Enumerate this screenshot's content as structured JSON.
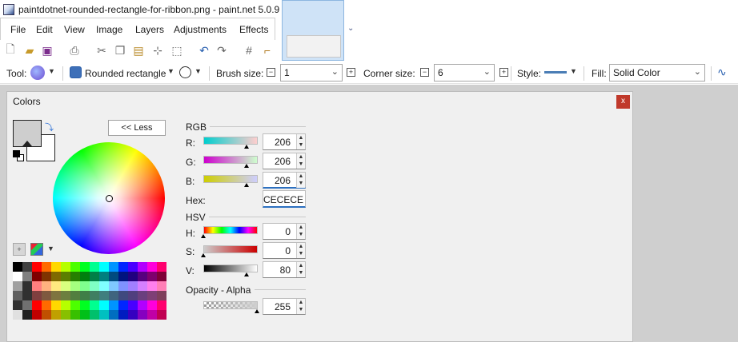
{
  "window": {
    "title": "paintdotnet-rounded-rectangle-for-ribbon.png - paint.net 5.0.9"
  },
  "menu": [
    "File",
    "Edit",
    "View",
    "Image",
    "Layers",
    "Adjustments",
    "Effects"
  ],
  "toolbar": {
    "icons": [
      "new-icon",
      "open-icon",
      "save-icon",
      "print-icon",
      "cut-icon",
      "copy-icon",
      "paste-icon",
      "crop-icon",
      "deselect-icon",
      "undo-icon",
      "redo-icon",
      "grid-icon",
      "ruler-icon"
    ]
  },
  "options": {
    "tool_label": "Tool:",
    "shape_label": "Rounded rectangle",
    "brush_size_label": "Brush size:",
    "brush_size_value": "1",
    "corner_size_label": "Corner size:",
    "corner_size_value": "6",
    "style_label": "Style:",
    "fill_label": "Fill:",
    "fill_value": "Solid Color",
    "style_color": "#4a7db5"
  },
  "colors_panel": {
    "title": "Colors",
    "close_label": "x",
    "less_label": "<< Less",
    "primary_color": "#cecece",
    "secondary_color": "#ffffff",
    "rgb_group": "RGB",
    "r_label": "R:",
    "r_value": "206",
    "g_label": "G:",
    "g_value": "206",
    "b_label": "B:",
    "b_value": "206",
    "hex_label": "Hex:",
    "hex_value": "CECECE",
    "hsv_group": "HSV",
    "h_label": "H:",
    "h_value": "0",
    "s_label": "S:",
    "s_value": "0",
    "v_label": "V:",
    "v_value": "80",
    "opacity_group": "Opacity - Alpha",
    "alpha_value": "255"
  },
  "palette": [
    [
      "#000000",
      "#404040",
      "#ff0000",
      "#ff6a00",
      "#ffd800",
      "#b6ff00",
      "#4cff00",
      "#00ff21",
      "#00ff90",
      "#00ffff",
      "#0094ff",
      "#0026ff",
      "#4800ff",
      "#b200ff",
      "#ff00dc",
      "#ff006e"
    ],
    [
      "#ffffff",
      "#808080",
      "#7f0000",
      "#7f3300",
      "#7f6a00",
      "#5b7f00",
      "#267f00",
      "#007f0e",
      "#007f46",
      "#007f7f",
      "#004a7f",
      "#00137f",
      "#21007f",
      "#57007f",
      "#7f006e",
      "#7f0037"
    ],
    [
      "#a0a0a0",
      "#303030",
      "#ff7f7f",
      "#ffb27f",
      "#ffe97f",
      "#daff7f",
      "#a5ff7f",
      "#7fff8e",
      "#7fffc5",
      "#7fffff",
      "#7fc9ff",
      "#7f92ff",
      "#a17fff",
      "#d67fff",
      "#ff7fed",
      "#ff7fb6"
    ],
    [
      "#606060",
      "#303030",
      "#7f3f3f",
      "#7f593f",
      "#7f743f",
      "#6d7f3f",
      "#527f3f",
      "#3f7f47",
      "#3f7f62",
      "#3f7f7f",
      "#3f647f",
      "#3f497f",
      "#503f7f",
      "#6b3f7f",
      "#7f3f76",
      "#7f3f5b"
    ],
    [
      "#303030",
      "#707070",
      "#ff0000",
      "#ff6a00",
      "#ffd800",
      "#b6ff00",
      "#4cff00",
      "#00ff21",
      "#00ff90",
      "#00ffff",
      "#0094ff",
      "#0026ff",
      "#4800ff",
      "#b200ff",
      "#ff00dc",
      "#ff006e"
    ],
    [
      "#e0e0e0",
      "#202020",
      "#c00000",
      "#c05000",
      "#c0a000",
      "#88c000",
      "#38c000",
      "#00c018",
      "#00c06c",
      "#00c0c0",
      "#006ec0",
      "#001cc0",
      "#3600c0",
      "#8600c0",
      "#c000a6",
      "#c00052"
    ]
  ]
}
